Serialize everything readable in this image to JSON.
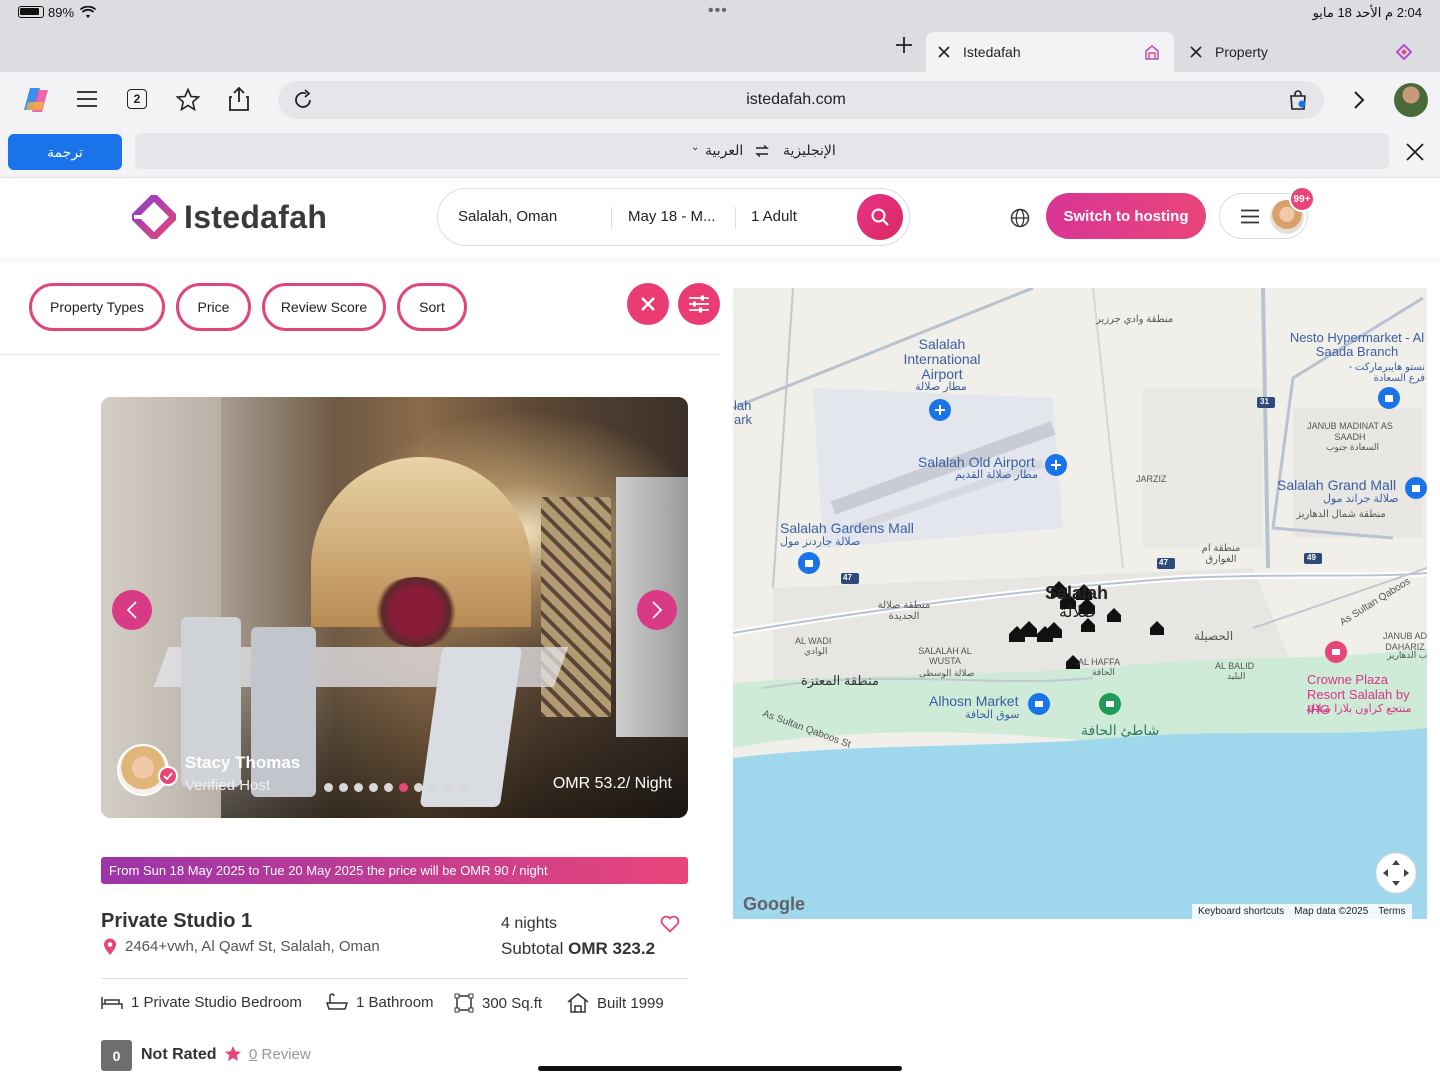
{
  "status_bar": {
    "battery": "89%",
    "time_date": "2:04 م  الأحد 18 مايو",
    "dots": "•••"
  },
  "browser": {
    "tabs": [
      {
        "label": "Istedafah"
      },
      {
        "label": "Property"
      }
    ],
    "tab_count": "2",
    "url": "istedafah.com"
  },
  "translate_bar": {
    "translate_button": "ترجمة",
    "target_lang": "العربية",
    "source_lang": "الإنجليزية"
  },
  "header": {
    "logo_text": "Istedafah",
    "search": {
      "location": "Salalah, Oman",
      "dates": "May 18 - M...",
      "guests": "1 Adult"
    },
    "hosting_button": "Switch to hosting",
    "notification_badge": "99+"
  },
  "filters": {
    "items": [
      "Property Types",
      "Price",
      "Review Score",
      "Sort"
    ]
  },
  "listing": {
    "host_name": "Stacy Thomas",
    "host_status": "Verified Host",
    "price_per_night": "OMR 53.2/ Night",
    "image_count": 10,
    "active_image_index": 5,
    "price_notice": "From Sun 18 May 2025 to Tue 20 May 2025 the price will be OMR 90 / night",
    "title": "Private Studio 1",
    "address": "2464+vwh, Al Qawf St, Salalah, Oman",
    "nights": "4 nights",
    "subtotal_label": "Subtotal",
    "subtotal_value": "OMR 323.2",
    "specs": [
      "1 Private Studio Bedroom",
      "1 Bathroom",
      "300 Sq.ft",
      "Built 1999"
    ],
    "rating_score": "0",
    "rating_label": "Not Rated",
    "review_count": "0",
    "review_label": "Review"
  },
  "map": {
    "labels": {
      "wadi": "منطقة وادي جرزير",
      "airport_en": "Salalah International Airport",
      "airport_ar": "مطار صلالة",
      "old_airport_en": "Salalah Old Airport",
      "old_airport_ar": "مطار صلالة القديم",
      "gardens_en": "Salalah Gardens Mall",
      "gardens_ar": "صلالة جاردنز مول",
      "nesto_en": "Nesto Hypermarket - Al Saada Branch",
      "nesto_ar": "نستو هايبرماركت - فرع السعادة",
      "janub_saadh": "JANUB MADINAT AS SAADH",
      "janub_saadh_ar": "السعادة جنوب",
      "jarziz": "JARZIZ",
      "grand_mall_en": "Salalah Grand Mall",
      "grand_mall_ar": "صلالة جراند مول",
      "dahariz": "منطقة شمال الدهاريز",
      "awqid": "منطقة ام الغوارق",
      "salalah_en": "Salalah",
      "salalah_ar": "صلالة",
      "jadeeda": "منطقة صلالة الجديدة",
      "wadi_district": "AL WADI",
      "wadi_district_ar": "الوادي",
      "wusta": "SALALAH AL WUSTA",
      "wusta_ar": "صلالة الوسطى",
      "haffa": "AL HAFFA",
      "haffa_ar": "الحافة",
      "husayla": "الحصيلة",
      "balid": "AL BALID",
      "balid_ar": "البليد",
      "janub_dahariz": "JANUB AD DAHARIZ",
      "janub_dahariz_ar": "جنوب الدهاريز",
      "muataza": "منطقة المعتزة",
      "alhosn_en": "Alhosn Market",
      "alhosn_ar": "سوق الحافة",
      "beach_ar": "شاطئ الحافة",
      "crowne_en": "Crowne Plaza Resort Salalah by IHG",
      "crowne_ar": "منتجع كراون بلازا صلالة",
      "road_west": "As Sultan Qaboos St",
      "road_east": "As Sultan Qaboos",
      "park_partial": "lah ark",
      "route_47": "47",
      "route_31": "31",
      "route_49": "49"
    },
    "footer": {
      "google": "Google",
      "shortcuts": "Keyboard shortcuts",
      "mapdata": "Map data ©2025",
      "terms": "Terms"
    }
  }
}
